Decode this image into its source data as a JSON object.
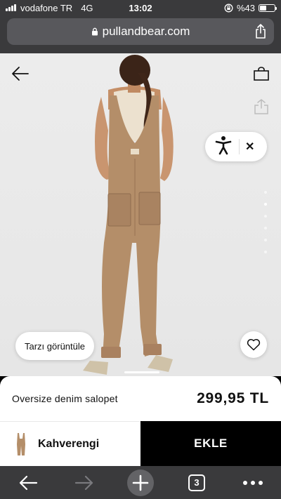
{
  "status": {
    "carrier": "vodafone TR",
    "network": "4G",
    "time": "13:02",
    "battery_label": "%43",
    "battery_level": 0.43
  },
  "browser": {
    "url": "pullandbear.com",
    "open_tabs": "3"
  },
  "product": {
    "name": "Oversize denim salopet",
    "price": "299,95 TL",
    "color_name": "Kahverengi",
    "style_button_label": "Tarzı görüntüle",
    "add_button_label": "EKLE",
    "image_count": 6,
    "active_image_index": 1
  },
  "icons": {
    "back": "arrow-left-icon",
    "bag": "shopping-bag-icon",
    "share": "share-icon",
    "accessibility": "accessibility-person-icon",
    "close": "close-icon",
    "favorite": "heart-icon"
  },
  "colors": {
    "primary_black": "#000000",
    "browser_chrome": "#3a3a3c",
    "garment_brown": "#b48e69"
  },
  "widgets": {
    "close_glyph": "✕"
  }
}
